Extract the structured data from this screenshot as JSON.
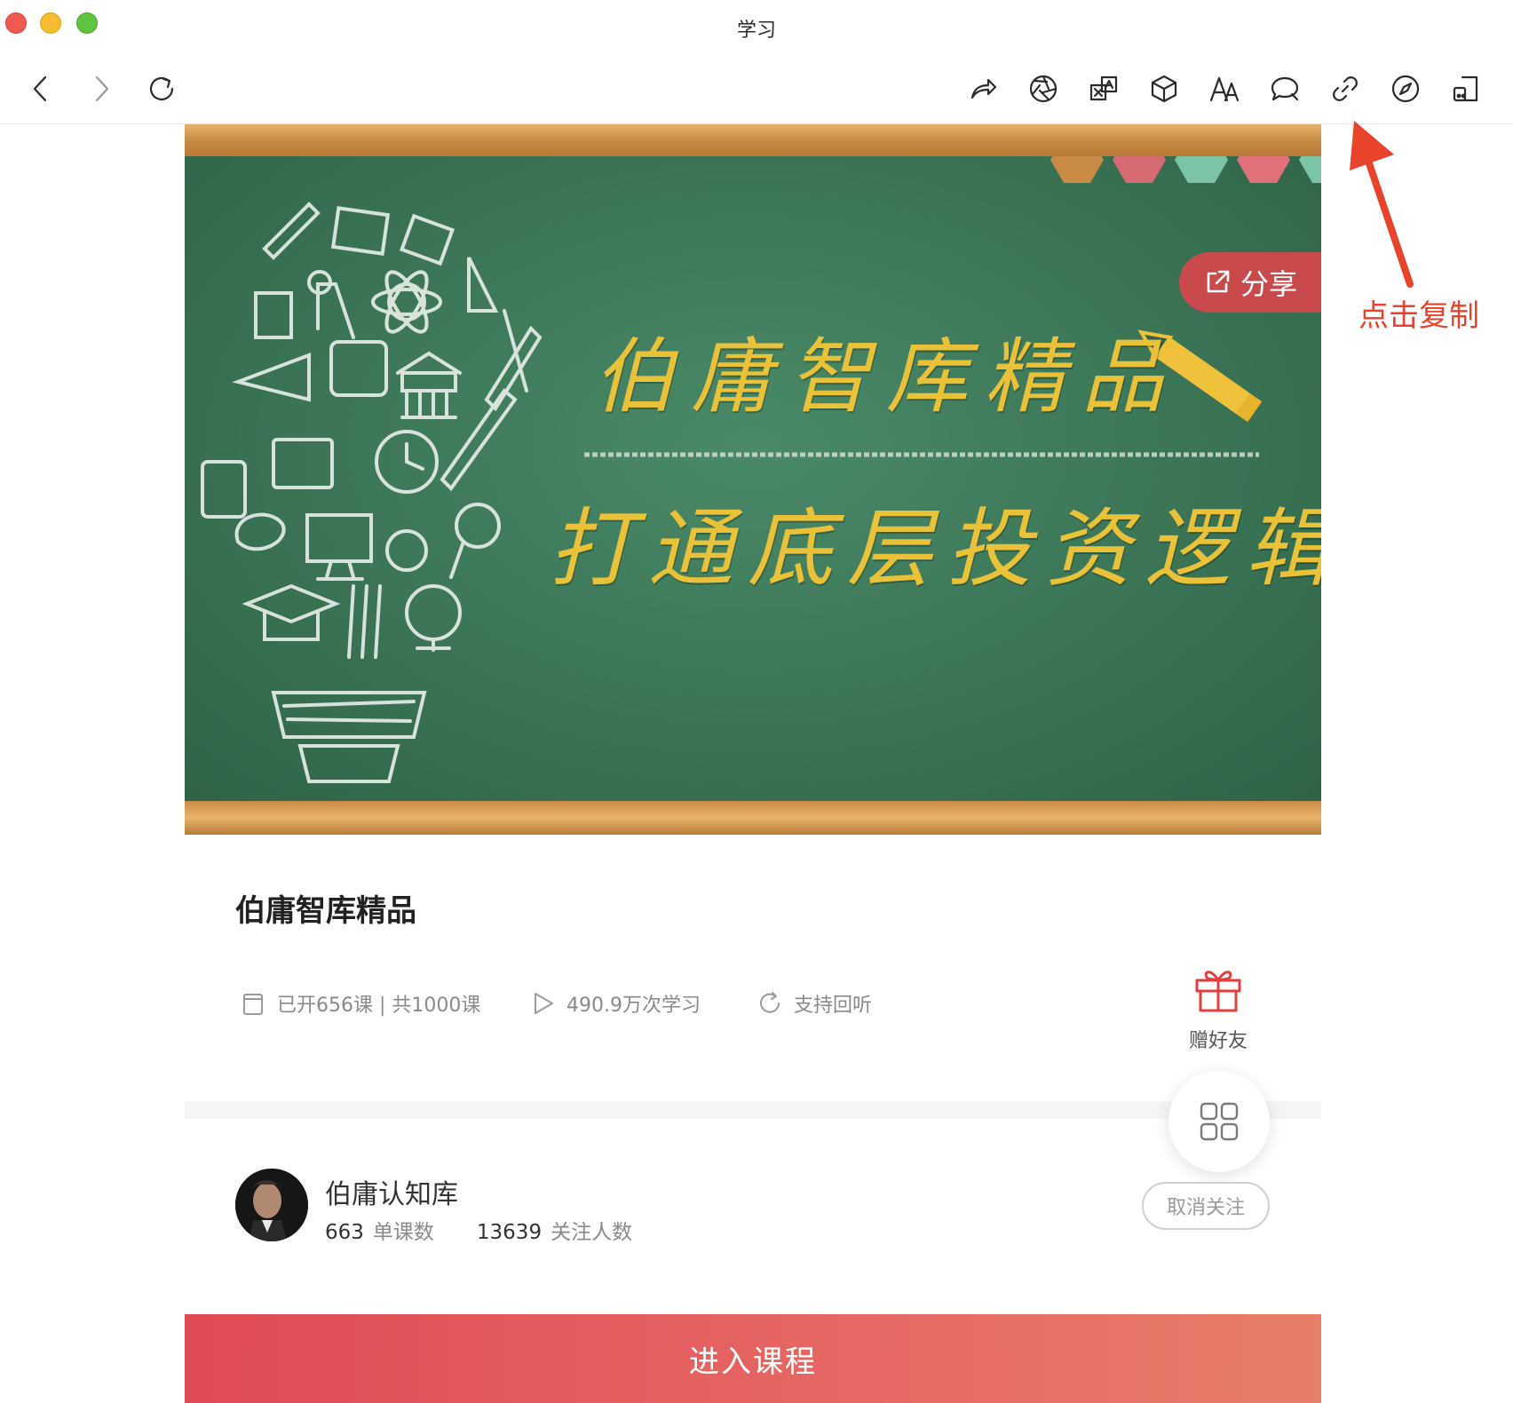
{
  "window": {
    "title": "学习"
  },
  "toolbar": {
    "left": [
      {
        "name": "back-button",
        "icon": "chevron-left-icon"
      },
      {
        "name": "forward-button",
        "icon": "chevron-right-icon"
      },
      {
        "name": "reload-button",
        "icon": "reload-icon"
      }
    ],
    "right": [
      {
        "name": "share-toolbar-button",
        "icon": "share-arrow-icon"
      },
      {
        "name": "aperture-button",
        "icon": "aperture-icon"
      },
      {
        "name": "translate-button",
        "icon": "translate-icon"
      },
      {
        "name": "cube-button",
        "icon": "cube-icon"
      },
      {
        "name": "font-size-button",
        "icon": "font-size-icon"
      },
      {
        "name": "comment-button",
        "icon": "chat-bubble-icon"
      },
      {
        "name": "copy-link-button",
        "icon": "link-icon"
      },
      {
        "name": "compass-button",
        "icon": "compass-icon"
      },
      {
        "name": "device-button",
        "icon": "device-icon"
      }
    ]
  },
  "banner": {
    "title": "伯庸智库精品",
    "subtitle": "打通底层投资逻辑",
    "share_label": "分享"
  },
  "annotation": {
    "text": "点击复制",
    "color": "#e8432b"
  },
  "course": {
    "title": "伯庸智库精品",
    "lessons": "已开656课 | 共1000课",
    "plays": "490.9万次学习",
    "replay": "支持回听",
    "gift_label": "赠好友"
  },
  "author": {
    "name": "伯庸认知库",
    "lesson_count": "663",
    "lesson_count_label": "单课数",
    "followers": "13639",
    "followers_label": "关注人数",
    "unfollow_label": "取消关注"
  },
  "enter_button": {
    "label": "进入课程"
  },
  "colors": {
    "accent": "#e14a57",
    "board": "#3e7a5a",
    "chalk_yellow": "#eac23a"
  }
}
